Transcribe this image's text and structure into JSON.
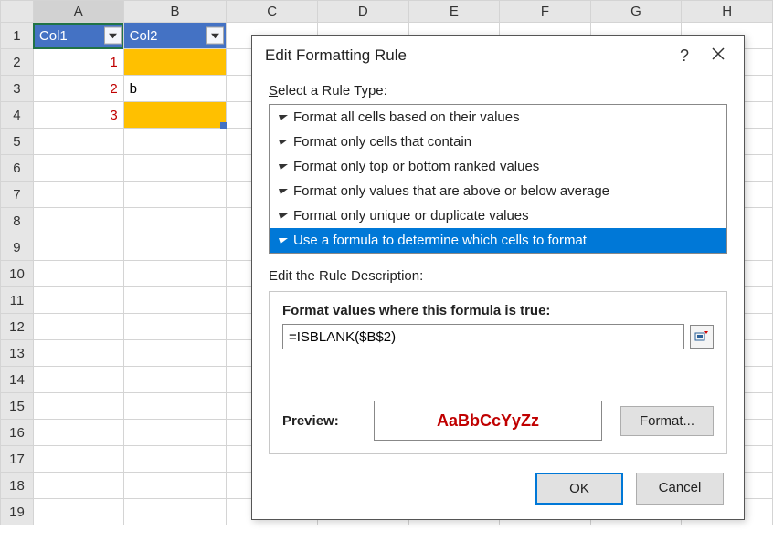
{
  "columns": [
    "A",
    "B",
    "C",
    "D",
    "E",
    "F",
    "G",
    "H"
  ],
  "rows": [
    1,
    2,
    3,
    4,
    5,
    6,
    7,
    8,
    9,
    10,
    11,
    12,
    13,
    14,
    15,
    16,
    17,
    18,
    19
  ],
  "table": {
    "headers": {
      "a": "Col1",
      "b": "Col2"
    },
    "data": [
      {
        "a": "1",
        "b": ""
      },
      {
        "a": "2",
        "b": "b"
      },
      {
        "a": "3",
        "b": ""
      }
    ]
  },
  "dialog": {
    "title": "Edit Formatting Rule",
    "select_label_pre": "S",
    "select_label_post": "elect a Rule Type:",
    "rule_types": [
      "Format all cells based on their values",
      "Format only cells that contain",
      "Format only top or bottom ranked values",
      "Format only values that are above or below average",
      "Format only unique or duplicate values",
      "Use a formula to determine which cells to format"
    ],
    "selected_type_index": 5,
    "edit_desc_label": "Edit the Rule Description:",
    "formula_label_pre": "F",
    "formula_label_mid": "o",
    "formula_label_post": "rmat values where this formula is true:",
    "formula": "=ISBLANK($B$2)",
    "preview_label": "Preview:",
    "preview_text": "AaBbCcYyZz",
    "format_btn_pre": "F",
    "format_btn_post": "ormat...",
    "ok": "OK",
    "cancel": "Cancel"
  }
}
